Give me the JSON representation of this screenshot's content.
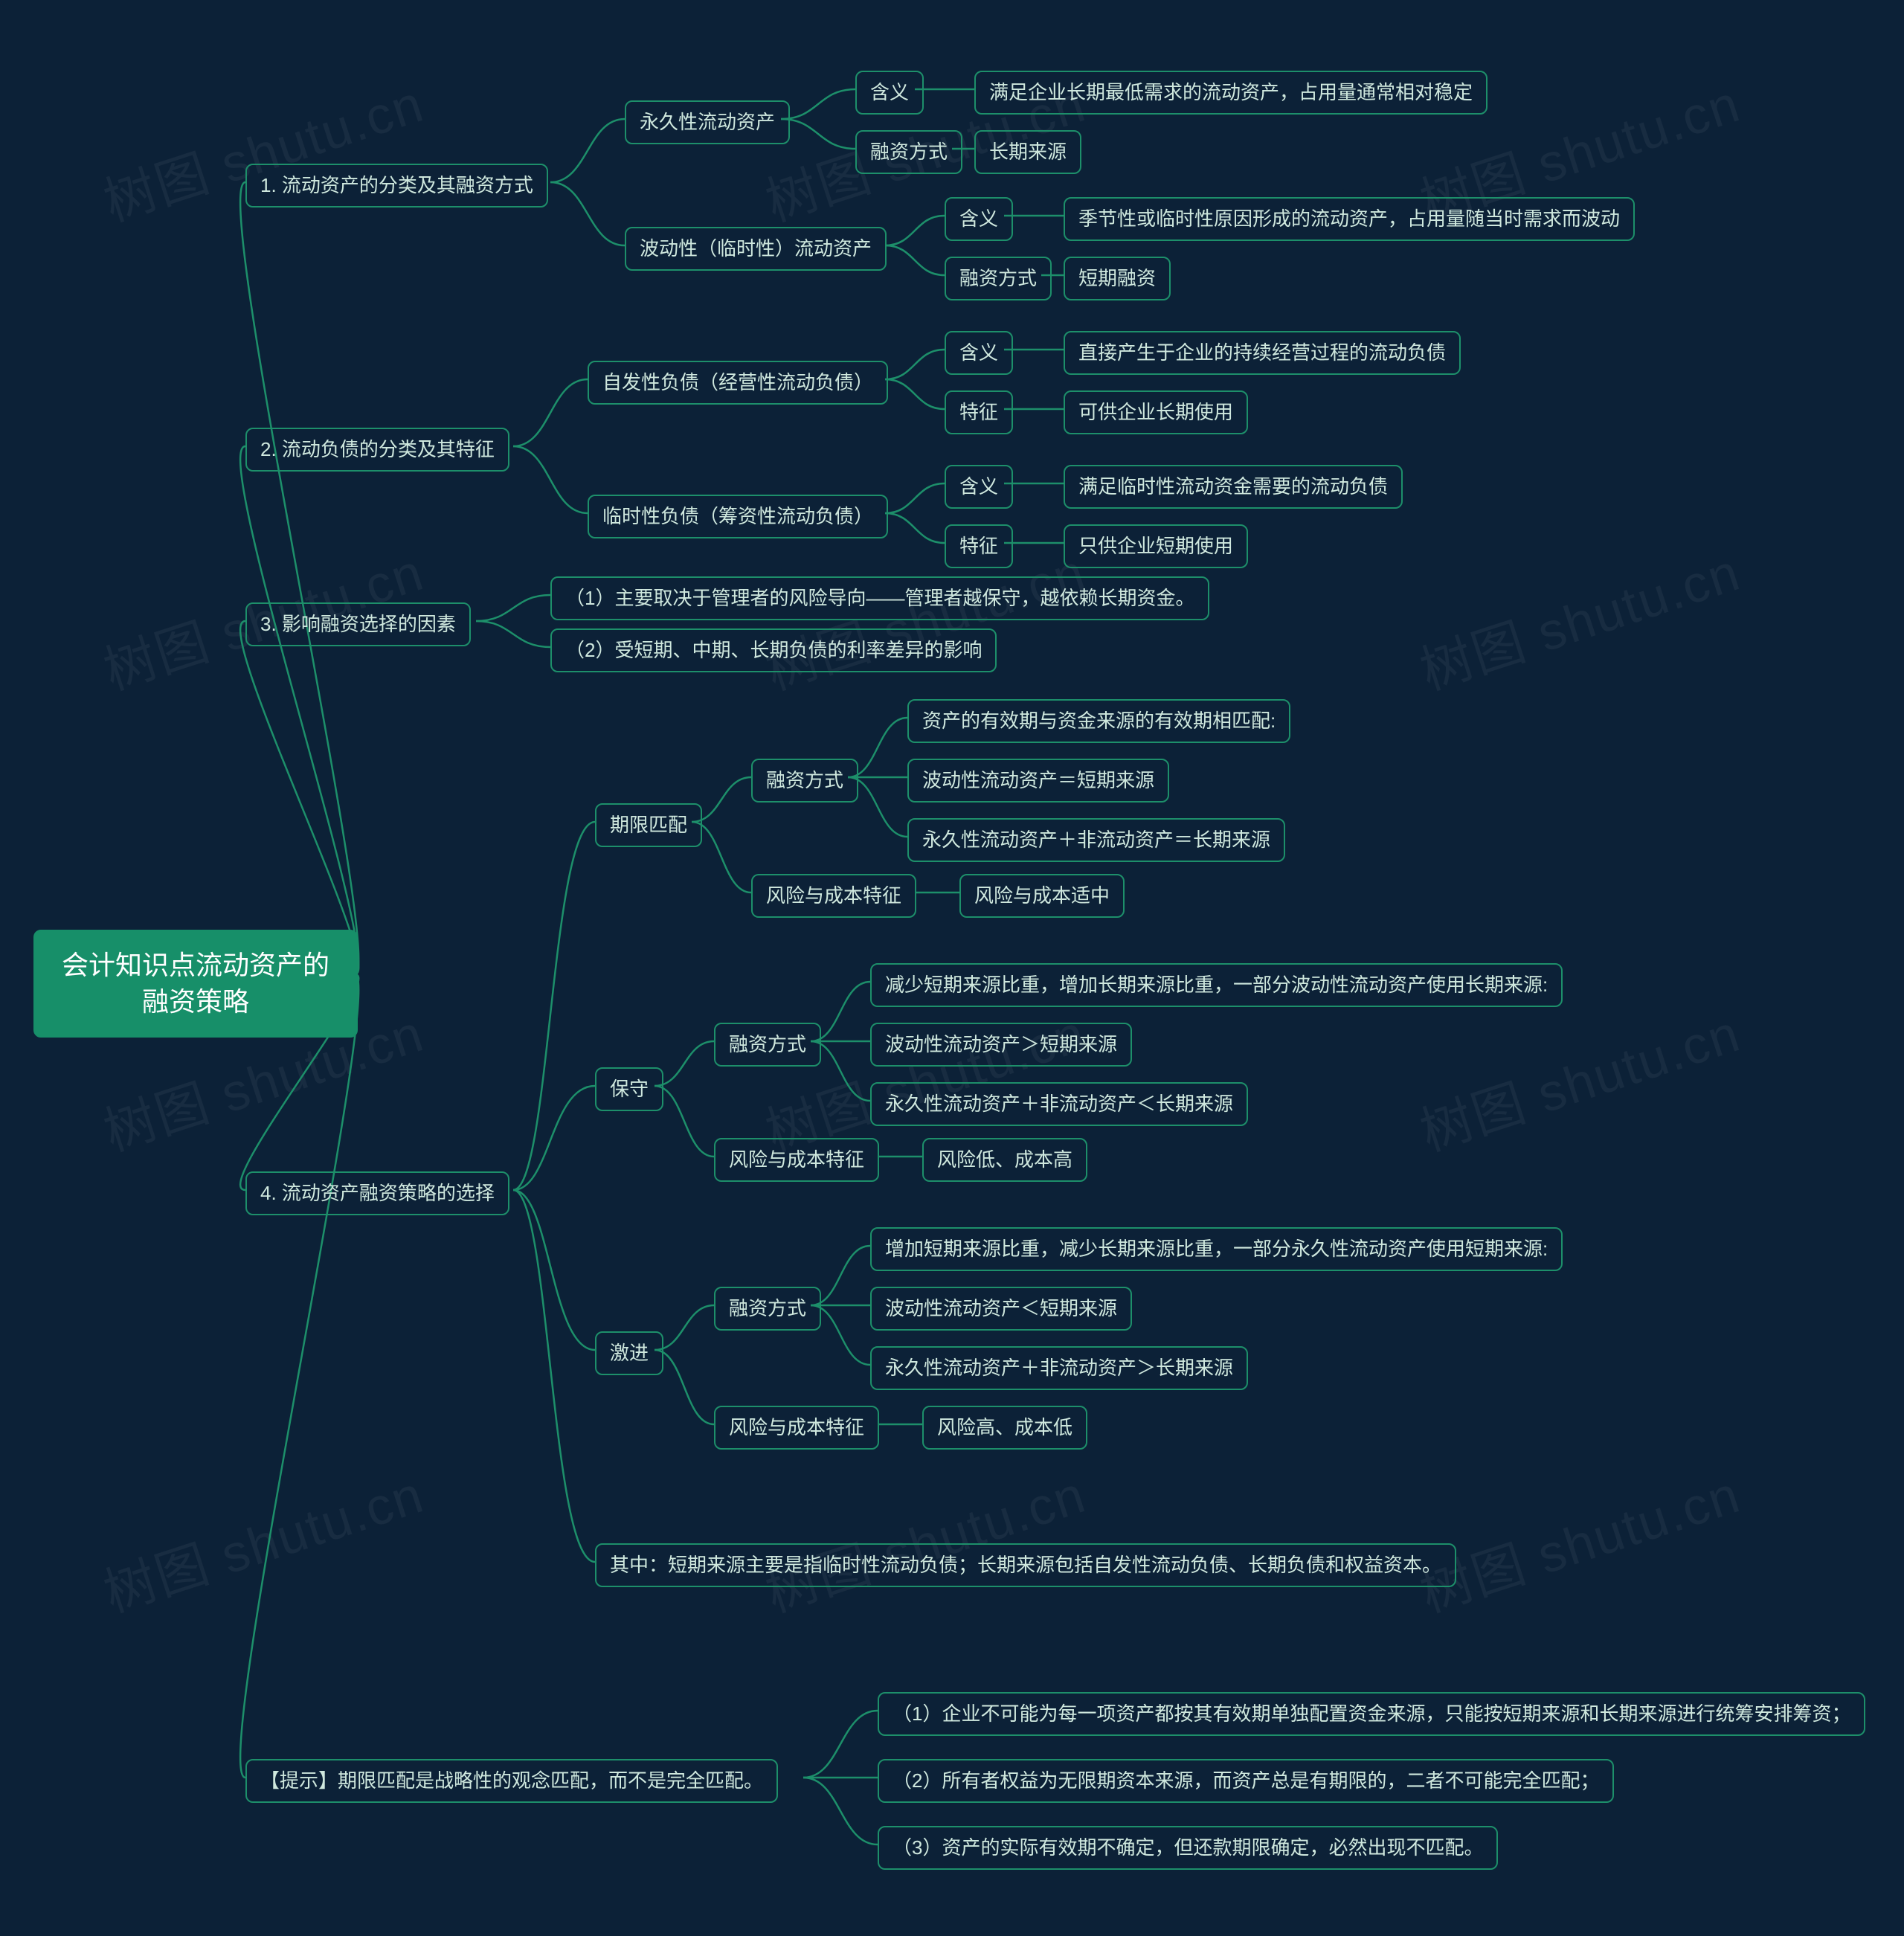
{
  "watermark": "树图 shutu.cn",
  "root": {
    "title": "会计知识点流动资产的融资策略"
  },
  "branches": [
    {
      "id": "b1",
      "label": "1. 流动资产的分类及其融资方式",
      "children": [
        {
          "id": "b1a",
          "label": "永久性流动资产",
          "children": [
            {
              "id": "b1a1",
              "label": "含义",
              "leaf": "满足企业长期最低需求的流动资产，占用量通常相对稳定"
            },
            {
              "id": "b1a2",
              "label": "融资方式",
              "leaf": "长期来源"
            }
          ]
        },
        {
          "id": "b1b",
          "label": "波动性（临时性）流动资产",
          "children": [
            {
              "id": "b1b1",
              "label": "含义",
              "leaf": "季节性或临时性原因形成的流动资产，占用量随当时需求而波动"
            },
            {
              "id": "b1b2",
              "label": "融资方式",
              "leaf": "短期融资"
            }
          ]
        }
      ]
    },
    {
      "id": "b2",
      "label": "2. 流动负债的分类及其特征",
      "children": [
        {
          "id": "b2a",
          "label": "自发性负债（经营性流动负债）",
          "children": [
            {
              "id": "b2a1",
              "label": "含义",
              "leaf": "直接产生于企业的持续经营过程的流动负债"
            },
            {
              "id": "b2a2",
              "label": "特征",
              "leaf": "可供企业长期使用"
            }
          ]
        },
        {
          "id": "b2b",
          "label": "临时性负债（筹资性流动负债）",
          "children": [
            {
              "id": "b2b1",
              "label": "含义",
              "leaf": "满足临时性流动资金需要的流动负债"
            },
            {
              "id": "b2b2",
              "label": "特征",
              "leaf": "只供企业短期使用"
            }
          ]
        }
      ]
    },
    {
      "id": "b3",
      "label": "3. 影响融资选择的因素",
      "children": [
        {
          "id": "b3a",
          "label": "（1）主要取决于管理者的风险导向——管理者越保守，越依赖长期资金。"
        },
        {
          "id": "b3b",
          "label": "（2）受短期、中期、长期负债的利率差异的影响"
        }
      ]
    },
    {
      "id": "b4",
      "label": "4. 流动资产融资策略的选择",
      "children": [
        {
          "id": "b4a",
          "label": "期限匹配",
          "children": [
            {
              "id": "b4a1",
              "label": "融资方式",
              "items": [
                "资产的有效期与资金来源的有效期相匹配:",
                "波动性流动资产＝短期来源",
                "永久性流动资产＋非流动资产＝长期来源"
              ]
            },
            {
              "id": "b4a2",
              "label": "风险与成本特征",
              "leaf": "风险与成本适中"
            }
          ]
        },
        {
          "id": "b4b",
          "label": "保守",
          "children": [
            {
              "id": "b4b1",
              "label": "融资方式",
              "items": [
                "减少短期来源比重，增加长期来源比重，一部分波动性流动资产使用长期来源:",
                "波动性流动资产＞短期来源",
                "永久性流动资产＋非流动资产＜长期来源"
              ]
            },
            {
              "id": "b4b2",
              "label": "风险与成本特征",
              "leaf": "风险低、成本高"
            }
          ]
        },
        {
          "id": "b4c",
          "label": "激进",
          "children": [
            {
              "id": "b4c1",
              "label": "融资方式",
              "items": [
                "增加短期来源比重，减少长期来源比重，一部分永久性流动资产使用短期来源:",
                "波动性流动资产＜短期来源",
                "永久性流动资产＋非流动资产＞长期来源"
              ]
            },
            {
              "id": "b4c2",
              "label": "风险与成本特征",
              "leaf": "风险高、成本低"
            }
          ]
        },
        {
          "id": "b4d",
          "label": "其中：短期来源主要是指临时性流动负债；长期来源包括自发性流动负债、长期负债和权益资本。"
        }
      ]
    },
    {
      "id": "b5",
      "label": "【提示】期限匹配是战略性的观念匹配，而不是完全匹配。",
      "children": [
        {
          "id": "b5a",
          "label": "（1）企业不可能为每一项资产都按其有效期单独配置资金来源，只能按短期来源和长期来源进行统筹安排筹资；"
        },
        {
          "id": "b5b",
          "label": "（2）所有者权益为无限期资本来源，而资产总是有期限的，二者不可能完全匹配；"
        },
        {
          "id": "b5c",
          "label": "（3）资产的实际有效期不确定，但还款期限确定，必然出现不匹配。"
        }
      ]
    }
  ]
}
